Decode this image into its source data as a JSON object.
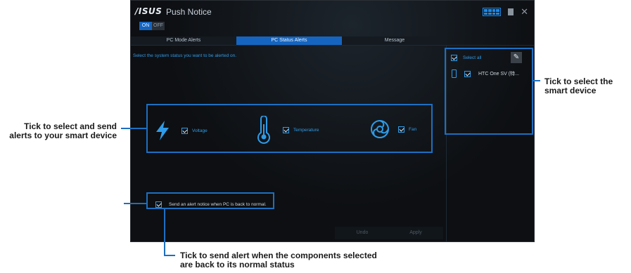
{
  "app": {
    "logo": "/ISUS",
    "title": "Push Notice",
    "toggle_on": "ON",
    "toggle_off": "OFF"
  },
  "tabs": [
    {
      "label": "PC Mode Alerts",
      "active": false
    },
    {
      "label": "PC Status Alerts",
      "active": true
    },
    {
      "label": "Message",
      "active": false
    }
  ],
  "main": {
    "instruction": "Select the system status you want to be alerted on.",
    "components": [
      {
        "label": "Voltage",
        "icon": "lightning-icon",
        "checked": true
      },
      {
        "label": "Temperature",
        "icon": "thermometer-icon",
        "checked": true
      },
      {
        "label": "Fan",
        "icon": "fan-icon",
        "checked": true
      }
    ],
    "normal_alert_label": "Send an alert notice when PC is back to normal.",
    "undo_label": "Undo",
    "apply_label": "Apply"
  },
  "devices": {
    "select_all_label": "Select all",
    "items": [
      {
        "name": "HTC One SV (特...",
        "checked": true
      }
    ]
  },
  "annotations": {
    "left_top": "Tick to select and send alerts to your smart device",
    "right": "Tick to select the smart device",
    "bottom": "Tick to send alert when the components selected are back to its normal status"
  },
  "colors": {
    "accent": "#1565c0",
    "text_blue": "#2f9be8",
    "highlight": "#1d6fc2"
  }
}
